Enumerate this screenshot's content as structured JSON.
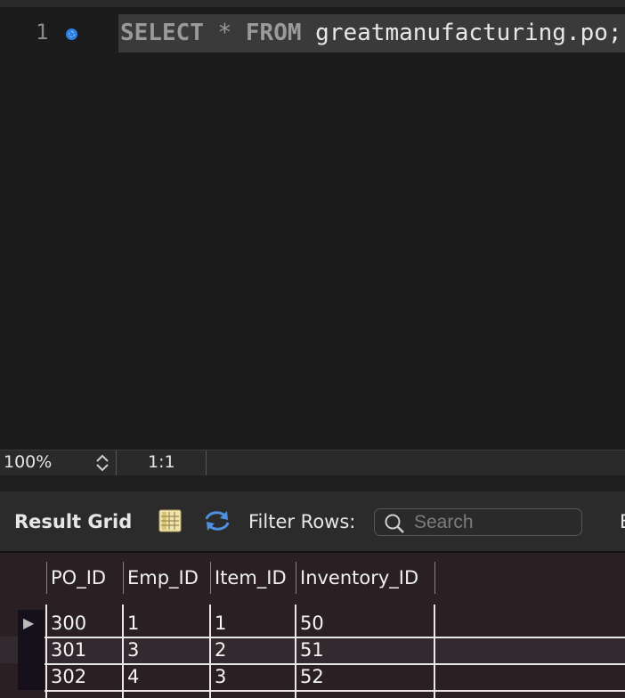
{
  "editor": {
    "line_number": "1",
    "query": {
      "select_kw": "SELECT",
      "star": "*",
      "from_kw": "FROM",
      "table": "greatmanufacturing.po;"
    }
  },
  "status": {
    "zoom": "100%",
    "cursor_pos": "1:1"
  },
  "toolbar": {
    "result_grid_label": "Result Grid",
    "filter_label": "Filter Rows:",
    "search_placeholder": "Search",
    "export_label": "E"
  },
  "grid": {
    "columns": [
      "PO_ID",
      "Emp_ID",
      "Item_ID",
      "Inventory_ID"
    ],
    "rows": [
      [
        "300",
        "1",
        "1",
        "50"
      ],
      [
        "301",
        "3",
        "2",
        "51"
      ],
      [
        "302",
        "4",
        "3",
        "52"
      ]
    ]
  },
  "colors": {
    "accent": "#2f7fe0",
    "editor_bg": "#1c1c1c",
    "grid_bg": "#2a2024"
  }
}
